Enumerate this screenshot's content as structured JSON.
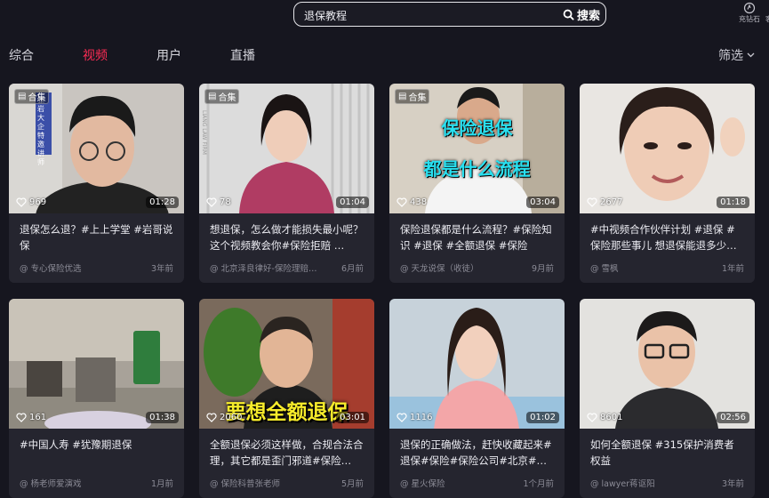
{
  "search": {
    "value": "退保教程",
    "button_label": "搜索"
  },
  "topbar": {
    "items": [
      {
        "label": "充钻石"
      },
      {
        "label": "客"
      }
    ]
  },
  "tabs": [
    {
      "label": "综合"
    },
    {
      "label": "视频"
    },
    {
      "label": "用户"
    },
    {
      "label": "直播"
    }
  ],
  "active_tab": "视频",
  "filter_label": "筛选",
  "collection_label": "合集",
  "colors": {
    "accent": "#fe2c55",
    "background": "#16161f",
    "card": "#25252f"
  },
  "videos": [
    {
      "likes": "969",
      "duration": "01:28",
      "desc": "退保怎么退？#上上学堂 #岩哥说保",
      "author": "@ 专心保险优选",
      "time": "3年前",
      "collection": true,
      "side_text": "张岩 大企特邀讲师"
    },
    {
      "likes": "78",
      "duration": "01:04",
      "desc": "想退保，怎么做才能损失最小呢？这个视频教会你#保险拒赔 …",
      "author": "@ 北京泽良律好-保险理赔…",
      "time": "6月前",
      "collection": true,
      "side_text": "LIANG LAW FIRM"
    },
    {
      "likes": "438",
      "duration": "03:04",
      "desc": "保险退保都是什么流程？#保险知识 #退保 #全额退保 #保险",
      "author": "@ 天龙说保（收徒）",
      "time": "9月前",
      "collection": true,
      "overlay_line1": "保险退保",
      "overlay_line2": "都是什么流程"
    },
    {
      "likes": "2677",
      "duration": "01:18",
      "desc": "#中视频合作伙伴计划 #退保 #保险那些事儿 想退保能退多少钱…",
      "author": "@ 雪枫",
      "time": "1年前",
      "collection": false
    },
    {
      "likes": "161",
      "duration": "01:38",
      "desc": "#中国人寿 #犹豫期退保",
      "author": "@ 杨老师爱演戏",
      "time": "1月前",
      "collection": false
    },
    {
      "likes": "2060",
      "duration": "03:01",
      "desc": "全额退保必须这样做，合规合法合理，其它都是歪门邪道#保险…",
      "author": "@ 保险科普张老师",
      "time": "5月前",
      "collection": false,
      "overlay_line1": "要想全额退保"
    },
    {
      "likes": "1116",
      "duration": "01:02",
      "desc": "退保的正确做法，赶快收藏起来#退保#保险#保险公司#北京#流…",
      "author": "@ 星火保险",
      "time": "1个月前",
      "collection": false
    },
    {
      "likes": "8601",
      "duration": "02:56",
      "desc": "如何全额退保 #315保护消费者权益",
      "author": "@ lawyer蒋讴阳",
      "time": "3年前",
      "collection": false
    }
  ]
}
